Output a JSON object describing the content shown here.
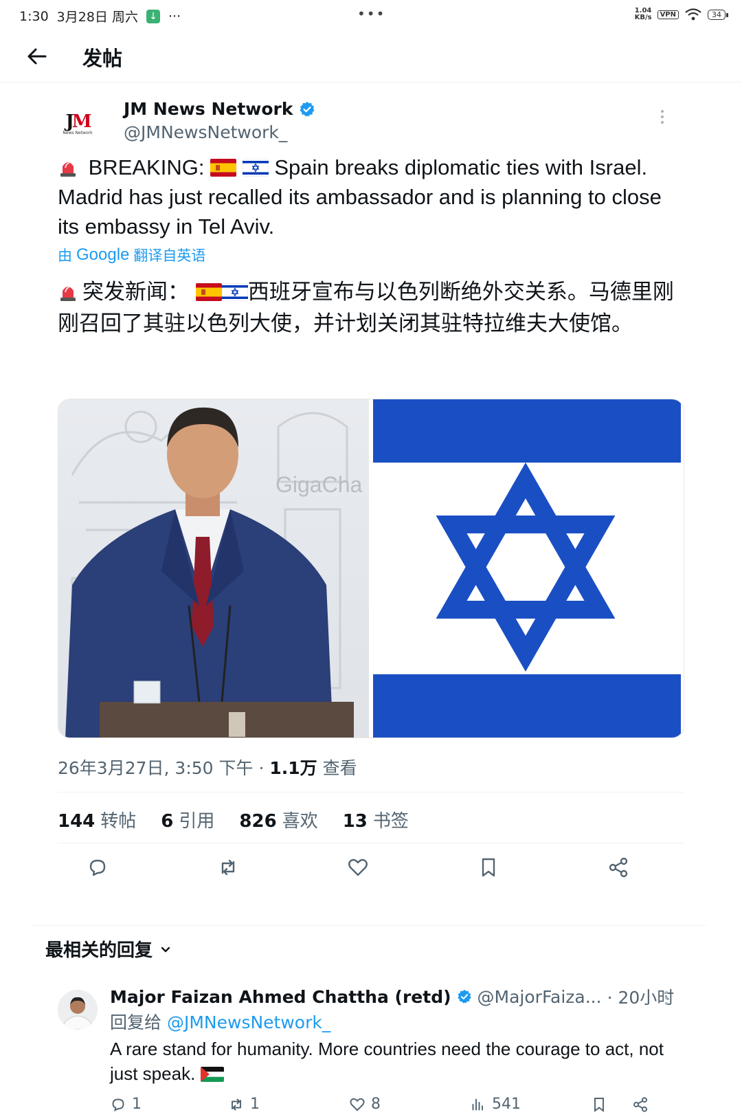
{
  "status_bar": {
    "time": "1:30",
    "date": "3月28日 周六",
    "overflow": "···",
    "center_dots": "•••",
    "net_speed_top": "1.04",
    "net_speed_bottom": "KB/s",
    "vpn": "VPN",
    "battery": "34"
  },
  "header": {
    "title": "发帖"
  },
  "tweet": {
    "author_name": "JM News Network",
    "author_handle": "@JMNewsNetwork_",
    "text_parts": {
      "prefix": "BREAKING:",
      "body": "Spain breaks diplomatic ties with Israel. Madrid has just recalled its ambassador and is planning to close its embassy in Tel Aviv."
    },
    "translate": {
      "by": "由",
      "google": "Google",
      "suffix": "翻译自英语"
    },
    "translated_parts": {
      "prefix": "突发新闻：",
      "body": "西班牙宣布与以色列断绝外交关系。马德里刚刚召回了其驻以色列大使，并计划关闭其驻特拉维夫大使馆。"
    },
    "media_watermark": "GigaCha",
    "meta": {
      "datetime": "26年3月27日, 3:50 下午 · ",
      "views_count": "1.1万",
      "views_label": " 查看"
    },
    "stats": [
      {
        "count": "144",
        "label": "转帖"
      },
      {
        "count": "6",
        "label": "引用"
      },
      {
        "count": "826",
        "label": "喜欢"
      },
      {
        "count": "13",
        "label": "书签"
      }
    ]
  },
  "replies": {
    "header_label": "最相关的回复",
    "items": [
      {
        "name": "Major Faizan Ahmed Chattha (retd)",
        "handle": "@MajorFaiza...",
        "time": "· 20小时",
        "reply_to_label": "回复给",
        "reply_to_handle": "@JMNewsNetwork_",
        "text": "A rare stand for humanity. More countries need the courage to act, not just speak.",
        "replies": "1",
        "reposts": "1",
        "likes": "8",
        "views": "541"
      }
    ]
  },
  "colors": {
    "accent": "#1d9bf0",
    "israel_blue": "#1a4fc4",
    "secondary_text": "#536471"
  }
}
